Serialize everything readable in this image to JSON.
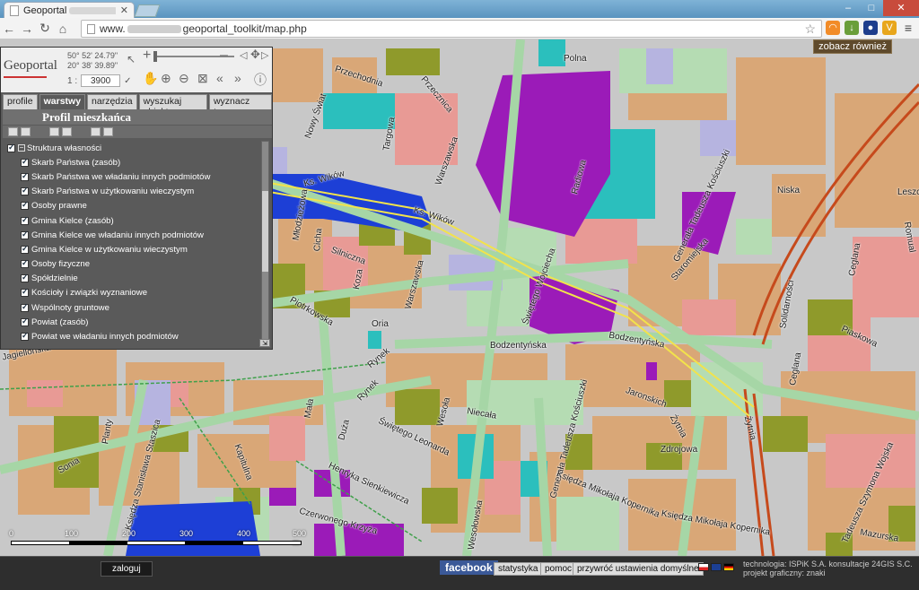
{
  "browser": {
    "tab_title": "Geoportal",
    "tab_close": "✕",
    "url_prefix": "www.",
    "url_path": "geoportal_toolkit/map.php",
    "back_icon": "←",
    "forward_icon": "→",
    "reload_icon": "↻",
    "home_icon": "⌂",
    "star_icon": "☆",
    "menu_icon": "≡",
    "win_min": "–",
    "win_max": "□",
    "win_close": "✕"
  },
  "see_also": "zobacz również",
  "panel": {
    "logo": "Geoportal",
    "coord_lat": "50° 52' 24.79\"",
    "coord_lon": "20° 38' 39.89\"",
    "scale_prefix": "1 :",
    "scale_value": "3900",
    "tabs": [
      {
        "label": "profile",
        "active": false
      },
      {
        "label": "warstwy",
        "active": true
      },
      {
        "label": "narzędzia",
        "active": false
      },
      {
        "label": "wyszukaj obiekt",
        "active": false
      },
      {
        "label": "wyznacz trasę",
        "active": false
      }
    ],
    "profile_title": "Profil mieszkańca",
    "layers_parent": "Struktura własności",
    "layers": [
      "Skarb Państwa (zasób)",
      "Skarb Państwa we władaniu innych podmiotów",
      "Skarb Państwa w użytkowaniu wieczystym",
      "Osoby prawne",
      "Gmina Kielce (zasób)",
      "Gmina Kielce we władaniu innych podmiotów",
      "Gmina Kielce w użytkowaniu wieczystym",
      "Osoby fizyczne",
      "Spółdzielnie",
      "Kościoły i związki wyznaniowe",
      "Wspólnoty gruntowe",
      "Powiat (zasób)",
      "Powiat we władaniu innych podmiotów"
    ]
  },
  "streets": [
    {
      "name": "Polna"
    },
    {
      "name": "Przechodnia"
    },
    {
      "name": "Przecznica"
    },
    {
      "name": "Nowy Świat"
    },
    {
      "name": "Targowa"
    },
    {
      "name": "Warszawska"
    },
    {
      "name": "Radiowa"
    },
    {
      "name": "Generała Tadeusza Kościuszki"
    },
    {
      "name": "Niska"
    },
    {
      "name": "Solidarności"
    },
    {
      "name": "Romual"
    },
    {
      "name": "Leszc"
    },
    {
      "name": "Ks. Wików"
    },
    {
      "name": "Ks. Wików"
    },
    {
      "name": "Młodzieżowa"
    },
    {
      "name": "Cicha"
    },
    {
      "name": "Silniczna"
    },
    {
      "name": "Koza"
    },
    {
      "name": "Staromiejska"
    },
    {
      "name": "Ceglana"
    },
    {
      "name": "Piotrkowska"
    },
    {
      "name": "Oria"
    },
    {
      "name": "Świętego Wojciecha"
    },
    {
      "name": "Warszawska"
    },
    {
      "name": "Bodzentyńska"
    },
    {
      "name": "Bodzentyńska"
    },
    {
      "name": "Piaskowa"
    },
    {
      "name": "Wesoła"
    },
    {
      "name": "Rynek"
    },
    {
      "name": "Rynek"
    },
    {
      "name": "Jaronskich"
    },
    {
      "name": "Ceglana"
    },
    {
      "name": "Świętego Leonarda"
    },
    {
      "name": "Niecała"
    },
    {
      "name": "Mała"
    },
    {
      "name": "Duża"
    },
    {
      "name": "Planty"
    },
    {
      "name": "Księdza Stanisława Staszica"
    },
    {
      "name": "Kapitulna"
    },
    {
      "name": "Henryka Sienkiewicza"
    },
    {
      "name": "Generała Tadeusza Kościuszki"
    },
    {
      "name": "Księdza Mikołaja Kopernika"
    },
    {
      "name": "Zdrojowa"
    },
    {
      "name": "Żytnia"
    },
    {
      "name": "Żytnia"
    },
    {
      "name": "Czerwonego Krzyża"
    },
    {
      "name": "Mazurska"
    },
    {
      "name": "Tadeusza Szymona Wojska"
    },
    {
      "name": "Wesołowska"
    },
    {
      "name": "Księdza Mikołaja Kopernika"
    },
    {
      "name": "Sonia"
    },
    {
      "name": "Jagiellońska"
    }
  ],
  "scalebar": {
    "labels": [
      "0",
      "100",
      "200",
      "300",
      "400",
      "500 m"
    ]
  },
  "footer": {
    "login": "zaloguj",
    "facebook": "facebook",
    "links": [
      "statystyka",
      "pomoc",
      "przywróć ustawienia domyślne"
    ],
    "credits_line1": "technologia: ISPiK S.A. konsultacje 24GIS S.C.",
    "credits_line2": "projekt graficzny: znaki"
  }
}
